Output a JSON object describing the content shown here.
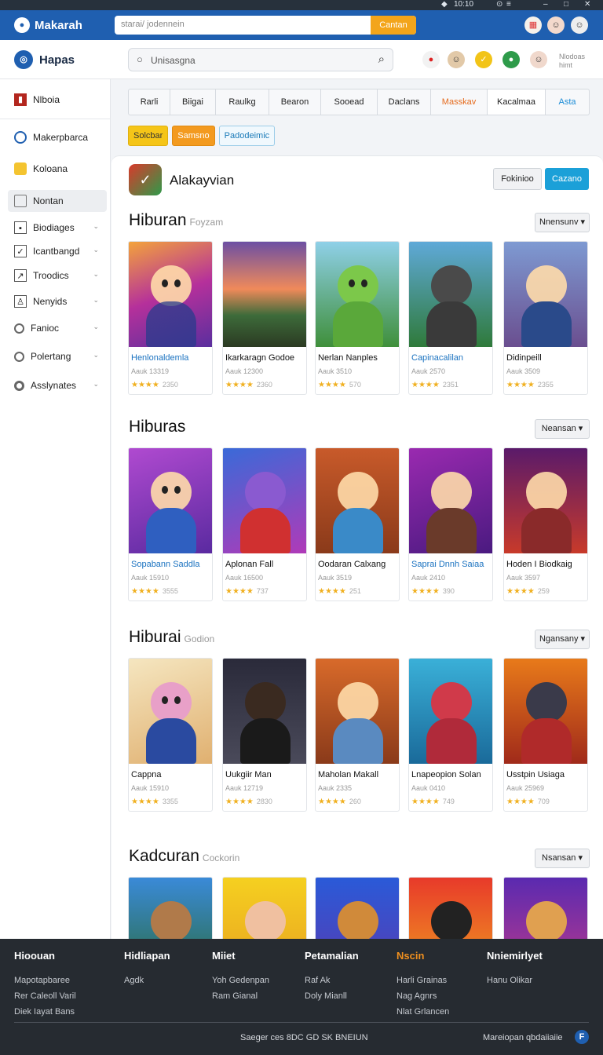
{
  "system_bar": {
    "time": "10:10",
    "icons": [
      "shield-icon",
      "clock-icon",
      "minimize-icon",
      "maximize-icon",
      "close-icon"
    ]
  },
  "topbar": {
    "brand": "Makarah",
    "search_placeholder": "starai/ jodennein",
    "search_button": "Cantan"
  },
  "header": {
    "logo": "Hapas",
    "search_placeholder": "Unisasgna",
    "side_text": "Nlodoas himt"
  },
  "sidebar": {
    "items": [
      {
        "label": "Nlboia",
        "icon": "book-icon"
      },
      {
        "label": "Makerpbarca",
        "icon": "circle-icon"
      },
      {
        "label": "Koloana",
        "icon": "folder-icon"
      },
      {
        "label": "Nontan",
        "icon": "tray-icon"
      },
      {
        "label": "Biodiages",
        "icon": "grid-icon"
      },
      {
        "label": "Icantbangd",
        "icon": "check-icon"
      },
      {
        "label": "Troodics",
        "icon": "chart-icon"
      },
      {
        "label": "Nenyids",
        "icon": "person-icon"
      },
      {
        "label": "Fanioc",
        "icon": "ring-icon"
      },
      {
        "label": "Polertang",
        "icon": "target-icon"
      },
      {
        "label": "Asslynates",
        "icon": "target-icon"
      }
    ]
  },
  "category_tabs": [
    "Rarli",
    "Biigai",
    "Raulkg",
    "Bearon",
    "Sooead",
    "Daclans",
    "Masskav",
    "Kacalmaa",
    "Asta"
  ],
  "chips": [
    "Solcbar",
    "Samsno",
    "Padodeimic"
  ],
  "panel": {
    "title": "Alakayvian",
    "btn_secondary": "Fokinioo",
    "btn_primary": "Cazano"
  },
  "sections": [
    {
      "title": "Hiburan",
      "subtitle": "Foyzam",
      "button": "Nnensunv",
      "cards": [
        {
          "name": "Henlonaldemla",
          "meta": "Aauk 13319",
          "rating": "2350"
        },
        {
          "name": "Ikarkaragn Godoe",
          "meta": "Aauk 12300",
          "rating": "2360"
        },
        {
          "name": "Nerlan Nanples",
          "meta": "Aauk 3510",
          "rating": "570"
        },
        {
          "name": "Capinacalilan",
          "meta": "Aauk 2570",
          "rating": "2351"
        },
        {
          "name": "Didinpeill",
          "meta": "Aauk 3509",
          "rating": "2355"
        }
      ]
    },
    {
      "title": "Hiburas",
      "subtitle": "",
      "button": "Neansan",
      "cards": [
        {
          "name": "Sopabann Saddla",
          "meta": "Aauk 15910",
          "rating": "3555"
        },
        {
          "name": "Aplonan Fall",
          "meta": "Aauk 16500",
          "rating": "737"
        },
        {
          "name": "Oodaran Calxang",
          "meta": "Aauk 3519",
          "rating": "251"
        },
        {
          "name": "Saprai Dnnh Saiaa",
          "meta": "Aauk 2410",
          "rating": "390"
        },
        {
          "name": "Hoden I Biodkaig",
          "meta": "Aauk 3597",
          "rating": "259"
        }
      ]
    },
    {
      "title": "Hiburai",
      "subtitle": "Godion",
      "button": "Ngansany",
      "cards": [
        {
          "name": "Cappna",
          "meta": "Aauk 15910",
          "rating": "3355"
        },
        {
          "name": "Uukgiir Man",
          "meta": "Aauk 12719",
          "rating": "2830"
        },
        {
          "name": "Maholan Makall",
          "meta": "Aauk 2335",
          "rating": "260"
        },
        {
          "name": "Lnapeopion Solan",
          "meta": "Aauk 0410",
          "rating": "749"
        },
        {
          "name": "Usstpin Usiaga",
          "meta": "Aauk 25969",
          "rating": "709"
        }
      ]
    },
    {
      "title": "Kadcuran",
      "subtitle": "Cockorin",
      "button": "Nsansan",
      "cards": [
        {
          "name": "",
          "meta": "",
          "rating": ""
        },
        {
          "name": "",
          "meta": "",
          "rating": ""
        },
        {
          "name": "",
          "meta": "",
          "rating": ""
        },
        {
          "name": "",
          "meta": "",
          "rating": ""
        },
        {
          "name": "",
          "meta": "",
          "rating": ""
        }
      ]
    }
  ],
  "footer": {
    "columns": [
      {
        "title": "Hioouan",
        "links": [
          "Mapotapbaree",
          "Rer Caleoll Varil",
          "Diek Iayat Bans"
        ]
      },
      {
        "title": "Hidliapan",
        "links": [
          "Agdk"
        ]
      },
      {
        "title": "Miiet",
        "links": [
          "Yoh Gedenpan",
          "Ram Gianal"
        ]
      },
      {
        "title": "Petamalian",
        "links": [
          "Raf Ak",
          "Doly Mianll"
        ]
      },
      {
        "title": "Nscin",
        "links": [
          "Harli Grainas",
          "Nag Agnrs",
          "Nlat Grlancen"
        ]
      },
      {
        "title": "Nniemirlyet",
        "links": [
          "Hanu Olikar"
        ]
      }
    ],
    "copyright": "Saeger ces 8DC GD SK BNEIUN",
    "right_text": "Mareiopan qbdaiiaiie",
    "right_icon_letter": "F"
  }
}
